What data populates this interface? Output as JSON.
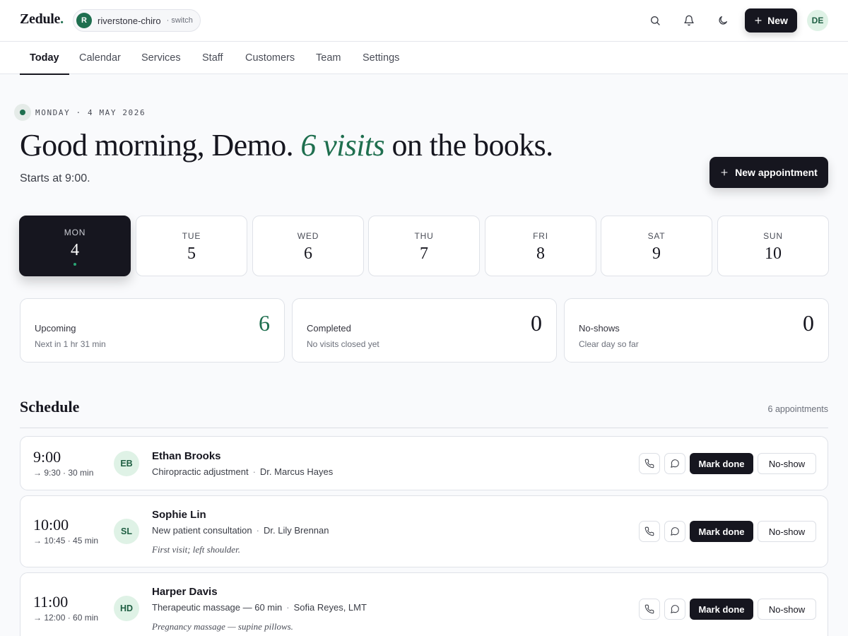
{
  "app": {
    "brand": "Zedule",
    "brand_dot": ".",
    "workspace": {
      "initial": "R",
      "name": "riverstone-chiro",
      "switch_label": "· switch"
    },
    "new_label": "New",
    "user_initials": "DE"
  },
  "nav": {
    "tabs": [
      {
        "label": "Today",
        "active": true
      },
      {
        "label": "Calendar"
      },
      {
        "label": "Services"
      },
      {
        "label": "Staff"
      },
      {
        "label": "Customers"
      },
      {
        "label": "Team"
      },
      {
        "label": "Settings"
      }
    ]
  },
  "hero": {
    "date_label": "MONDAY · 4 MAY 2026",
    "greeting_prefix": "Good morning, Demo.",
    "greeting_highlight": "6 visits",
    "greeting_suffix": "on the books.",
    "subline": "Starts at 9:00.",
    "new_appointment_label": "New appointment"
  },
  "week": [
    {
      "day": "MON",
      "num": "4",
      "active": true
    },
    {
      "day": "TUE",
      "num": "5"
    },
    {
      "day": "WED",
      "num": "6"
    },
    {
      "day": "THU",
      "num": "7"
    },
    {
      "day": "FRI",
      "num": "8"
    },
    {
      "day": "SAT",
      "num": "9"
    },
    {
      "day": "SUN",
      "num": "10"
    }
  ],
  "stats": [
    {
      "label": "Upcoming",
      "value": "6",
      "sub": "Next in 1 hr 31 min"
    },
    {
      "label": "Completed",
      "value": "0",
      "sub": "No visits closed yet"
    },
    {
      "label": "No-shows",
      "value": "0",
      "sub": "Clear day so far"
    }
  ],
  "schedule": {
    "title": "Schedule",
    "count": "6 appointments",
    "mark_done_label": "Mark done",
    "no_show_label": "No-show",
    "appointments": [
      {
        "time": "9:00",
        "end": "→ 9:30 · 30 min",
        "initials": "EB",
        "name": "Ethan Brooks",
        "service": "Chiropractic adjustment",
        "provider": "Dr. Marcus Hayes",
        "note": ""
      },
      {
        "time": "10:00",
        "end": "→ 10:45 · 45 min",
        "initials": "SL",
        "name": "Sophie Lin",
        "service": "New patient consultation",
        "provider": "Dr. Lily Brennan",
        "note": "First visit; left shoulder."
      },
      {
        "time": "11:00",
        "end": "→ 12:00 · 60 min",
        "initials": "HD",
        "name": "Harper Davis",
        "service": "Therapeutic massage — 60 min",
        "provider": "Sofia Reyes, LMT",
        "note": "Pregnancy massage — supine pillows."
      }
    ]
  },
  "colors": {
    "accent": "#1f6f4f",
    "ink": "#16161f",
    "background": "#f9fafc",
    "avatar_bg": "#dff2e6"
  },
  "icons": [
    "search-icon",
    "bell-icon",
    "moon-icon",
    "plus-icon",
    "phone-icon",
    "message-icon"
  ]
}
